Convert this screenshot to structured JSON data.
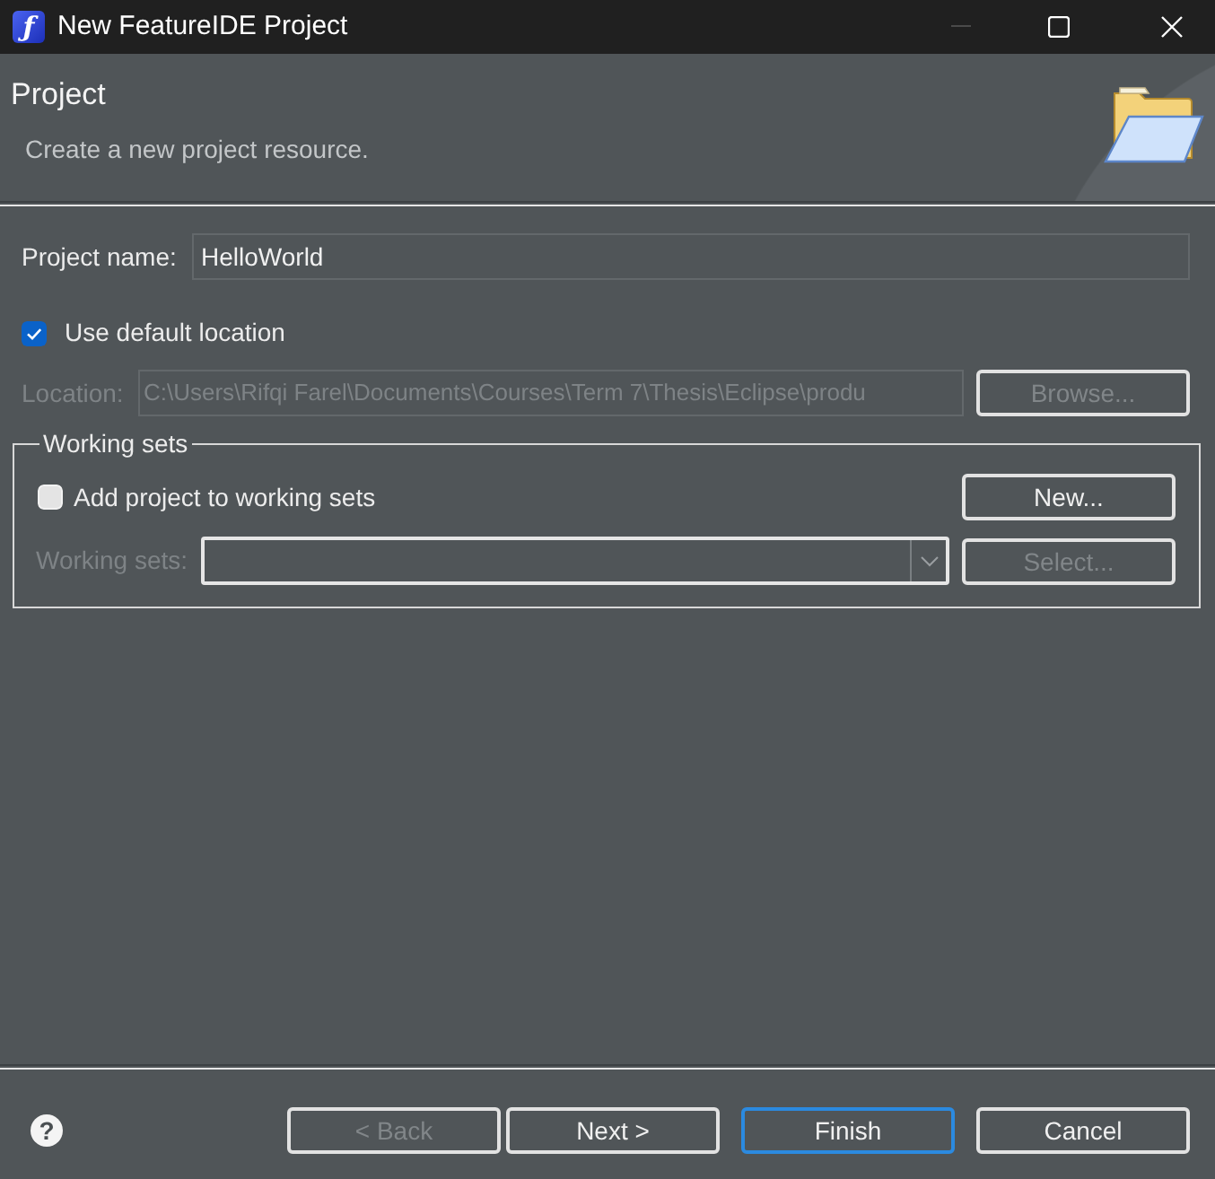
{
  "window": {
    "title": "New FeatureIDE Project",
    "logo_glyph": "ƒ",
    "controls": [
      {
        "kind": "minimize",
        "disabled": true
      },
      {
        "kind": "maximize",
        "disabled": false
      },
      {
        "kind": "close",
        "disabled": false
      }
    ]
  },
  "header": {
    "title": "Project",
    "description": "Create a new project resource."
  },
  "project_name": {
    "label": "Project name:",
    "value": "HelloWorld"
  },
  "default_location": {
    "label": "Use default location",
    "checked": true
  },
  "location": {
    "label": "Location:",
    "value": "C:\\Users\\Rifqi Farel\\Documents\\Courses\\Term 7\\Thesis\\Eclipse\\produ",
    "disabled": true,
    "button": {
      "label": "Browse...",
      "disabled": true
    }
  },
  "working_sets": {
    "title": "Working sets",
    "add": {
      "label": "Add project to working sets",
      "checked": false
    },
    "new_button": {
      "label": "New...",
      "disabled": false
    },
    "sets": {
      "label": "Working sets:",
      "disabled": true
    },
    "select_button": {
      "label": "Select...",
      "disabled": true
    }
  },
  "help": {
    "glyph": "?"
  },
  "buttons": [
    {
      "label": "< Back",
      "disabled": true,
      "default": false
    },
    {
      "label": "Next >",
      "disabled": false,
      "default": false
    },
    {
      "label": "Finish",
      "disabled": false,
      "default": true
    },
    {
      "label": "Cancel",
      "disabled": false,
      "default": false
    }
  ]
}
